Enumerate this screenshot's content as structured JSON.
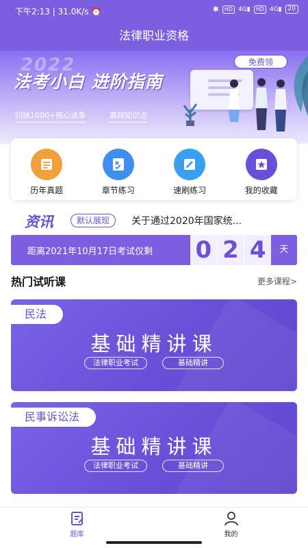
{
  "status_bar": {
    "time": "下午2:13",
    "speed": "31.0K/s",
    "hd1": "HD",
    "net1": "4G",
    "hd2": "HD",
    "net2": "4G",
    "battery": "20"
  },
  "header": {
    "title": "法律职业资格"
  },
  "banner": {
    "year": "2022",
    "headline": "法考小白 进阶指南",
    "tag1": "归纳1000+核心法条",
    "tag2": "高频知识点",
    "free_button": "免费领"
  },
  "quick_nav": [
    {
      "label": "历年真题",
      "icon": "document-icon",
      "color": "#f3a03a"
    },
    {
      "label": "章节练习",
      "icon": "checklist-icon",
      "color": "#3f8ff0"
    },
    {
      "label": "速刷练习",
      "icon": "pencil-icon",
      "color": "#3a9ff0"
    },
    {
      "label": "我的收藏",
      "icon": "star-icon",
      "color": "#6a4fd8"
    }
  ],
  "news": {
    "logo": "资讯",
    "badge": "默认展现",
    "headline": "关于通过2020年国家统..."
  },
  "countdown": {
    "label": "距离2021年10月17日考试仅剩",
    "digits": [
      "0",
      "2",
      "4"
    ],
    "unit": "天"
  },
  "courses_section": {
    "title": "热门试听课",
    "more": "更多课程>"
  },
  "courses": [
    {
      "tag": "民法",
      "title": "基础精讲课",
      "chips": [
        "法律职业考试",
        "基础精讲"
      ]
    },
    {
      "tag": "民事诉讼法",
      "title": "基础精讲课",
      "chips": [
        "法律职业考试",
        "基础精讲"
      ]
    }
  ],
  "tabbar": [
    {
      "label": "题库",
      "icon": "question-bank-icon",
      "active": true
    },
    {
      "label": "我的",
      "icon": "profile-icon",
      "active": false
    }
  ],
  "colors": {
    "primary": "#7b5fe0",
    "accent": "#6a4fd8"
  }
}
